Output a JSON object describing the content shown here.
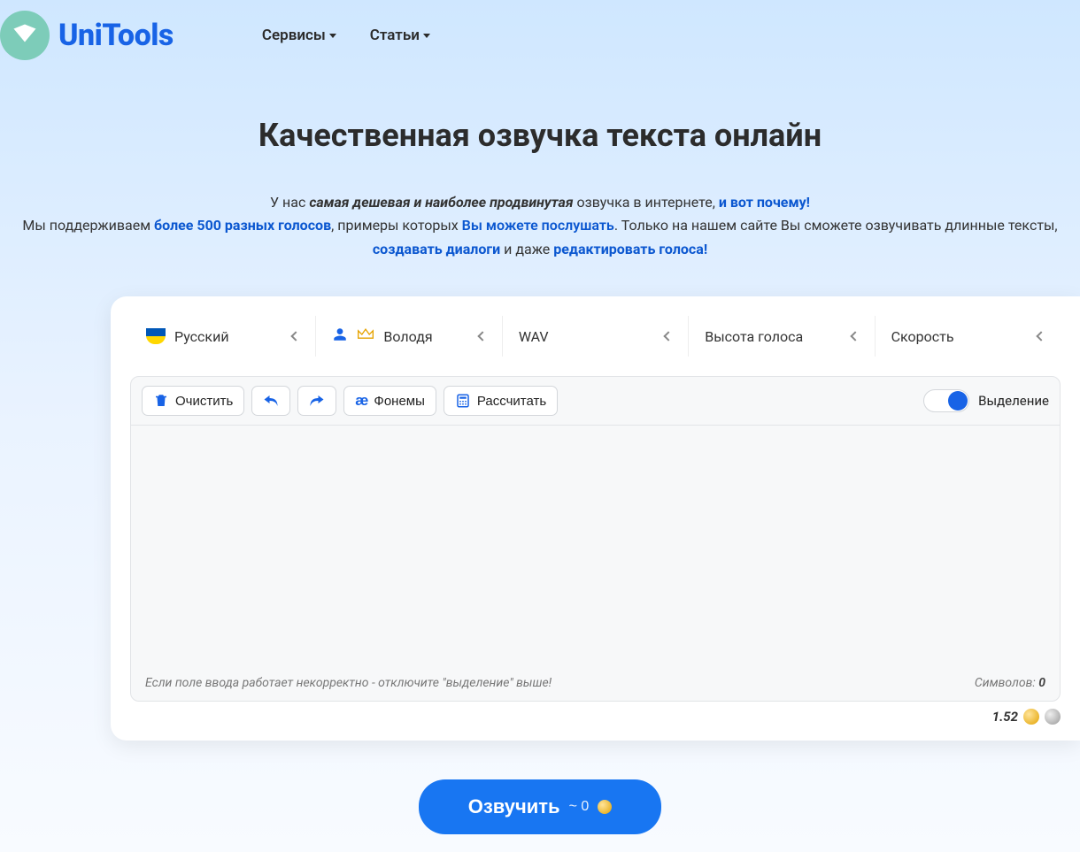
{
  "brand": {
    "name": "UniTools"
  },
  "nav": {
    "services": "Сервисы",
    "articles": "Статьи"
  },
  "hero": {
    "title": "Качественная озвучка текста онлайн"
  },
  "intro": {
    "line1_a": "У нас ",
    "line1_b": "самая дешевая и наиболее продвинутая",
    "line1_c": " озвучка в интернете, ",
    "line1_d": "и вот почему!",
    "line2_a": "Мы поддерживаем ",
    "line2_b": "более 500 разных голосов",
    "line2_c": ", примеры которых ",
    "line2_d": "Вы можете послушать",
    "line2_e": ". Только на нашем сайте Вы сможете озвучивать длинные тексты, ",
    "line2_f": "создавать диалоги",
    "line2_g": " и даже ",
    "line2_h": "редактировать голоса!"
  },
  "selectors": {
    "language": "Русский",
    "voice": "Володя",
    "format": "WAV",
    "pitch": "Высота голоса",
    "speed": "Скорость"
  },
  "toolbar": {
    "clear": "Очистить",
    "phonemes": "Фонемы",
    "calculate": "Рассчитать",
    "toggle_label": "Выделение"
  },
  "editor": {
    "value": "",
    "hint": "Если поле ввода работает некорректно - отключите \"выделение\" выше!",
    "char_label": "Символов: ",
    "char_count": "0"
  },
  "pricing": {
    "value": "1.52"
  },
  "cta": {
    "label": "Озвучить",
    "approx": "~ 0"
  }
}
